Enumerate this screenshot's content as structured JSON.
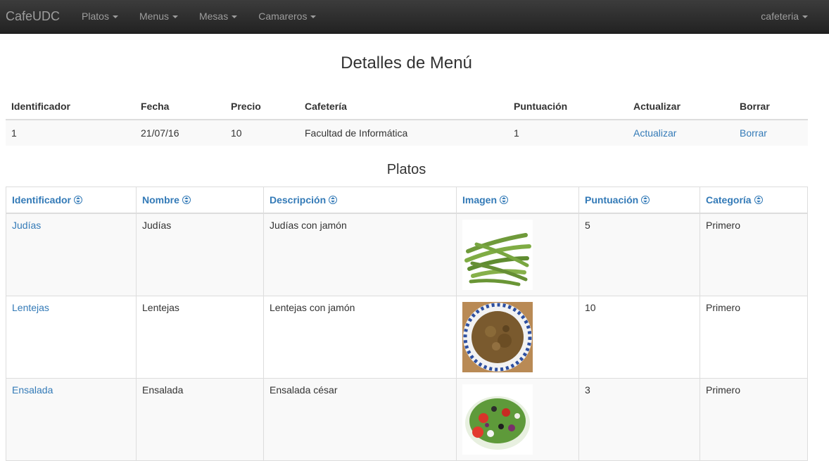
{
  "navbar": {
    "brand": "CafeUDC",
    "items": [
      {
        "label": "Platos"
      },
      {
        "label": "Menus"
      },
      {
        "label": "Mesas"
      },
      {
        "label": "Camareros"
      }
    ],
    "user": "cafeteria"
  },
  "details": {
    "title": "Detalles de Menú",
    "headers": [
      "Identificador",
      "Fecha",
      "Precio",
      "Cafetería",
      "Puntuación",
      "Actualizar",
      "Borrar"
    ],
    "row": {
      "id": "1",
      "fecha": "21/07/16",
      "precio": "10",
      "cafeteria": "Facultad de Informática",
      "puntuacion": "1",
      "actualizar": "Actualizar",
      "borrar": "Borrar"
    }
  },
  "platos": {
    "title": "Platos",
    "headers": [
      "Identificador",
      "Nombre",
      "Descripción",
      "Imagen",
      "Puntuación",
      "Categoría"
    ],
    "rows": [
      {
        "id": "Judías",
        "nombre": "Judías",
        "descripcion": "Judías con jamón",
        "image": "green-beans-image",
        "puntuacion": "5",
        "categoria": "Primero"
      },
      {
        "id": "Lentejas",
        "nombre": "Lentejas",
        "descripcion": "Lentejas con jamón",
        "image": "lentil-soup-image",
        "puntuacion": "10",
        "categoria": "Primero"
      },
      {
        "id": "Ensalada",
        "nombre": "Ensalada",
        "descripcion": "Ensalada césar",
        "image": "salad-image",
        "puntuacion": "3",
        "categoria": "Primero"
      }
    ]
  },
  "colors": {
    "navbar_bg": "#222222",
    "nav_text": "#9d9d9d",
    "link": "#337ab7",
    "stripe": "#f9f9f9"
  }
}
